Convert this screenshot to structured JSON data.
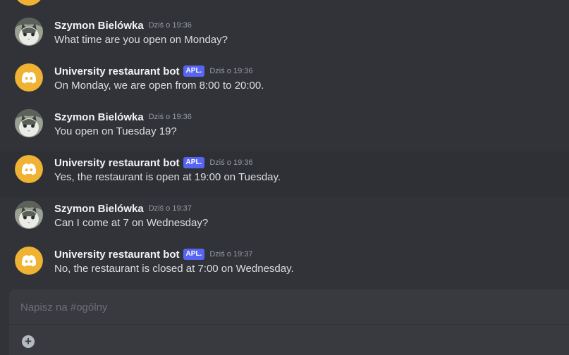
{
  "channel": {
    "composer_placeholder": "Napisz na #ogólny"
  },
  "colors": {
    "background": "#313338",
    "bot_avatar": "#f0b232",
    "app_badge": "#5865f2",
    "author_text": "#f2f3f5",
    "message_text": "#dbdee1",
    "timestamp_text": "#949ba4"
  },
  "messages": [
    {
      "author": "Szymon Bielówka",
      "is_bot": false,
      "avatar_icon": "cat-photo-avatar",
      "timestamp": "Dziś o 19:36",
      "text": "What time are you open on Monday?"
    },
    {
      "author": "University restaurant bot",
      "is_bot": true,
      "badge": "APL.",
      "avatar_icon": "discord-logo-avatar",
      "timestamp": "Dziś o 19:36",
      "text": "On Monday, we are open from 8:00 to 20:00."
    },
    {
      "author": "Szymon Bielówka",
      "is_bot": false,
      "avatar_icon": "cat-photo-avatar",
      "timestamp": "Dziś o 19:36",
      "text": "You open on Tuesday 19?"
    },
    {
      "author": "University restaurant bot",
      "is_bot": true,
      "badge": "APL.",
      "avatar_icon": "discord-logo-avatar",
      "timestamp": "Dziś o 19:36",
      "text": "Yes, the restaurant is open at 19:00 on Tuesday."
    },
    {
      "author": "Szymon Bielówka",
      "is_bot": false,
      "avatar_icon": "cat-photo-avatar",
      "timestamp": "Dziś o 19:37",
      "text": "Can I come at 7 on Wednesday?"
    },
    {
      "author": "University restaurant bot",
      "is_bot": true,
      "badge": "APL.",
      "avatar_icon": "discord-logo-avatar",
      "timestamp": "Dziś o 19:37",
      "text": "No, the restaurant is closed at 7:00 on Wednesday."
    }
  ],
  "composer": {
    "add_icon": "plus-circle-icon",
    "add_glyph": "+"
  }
}
